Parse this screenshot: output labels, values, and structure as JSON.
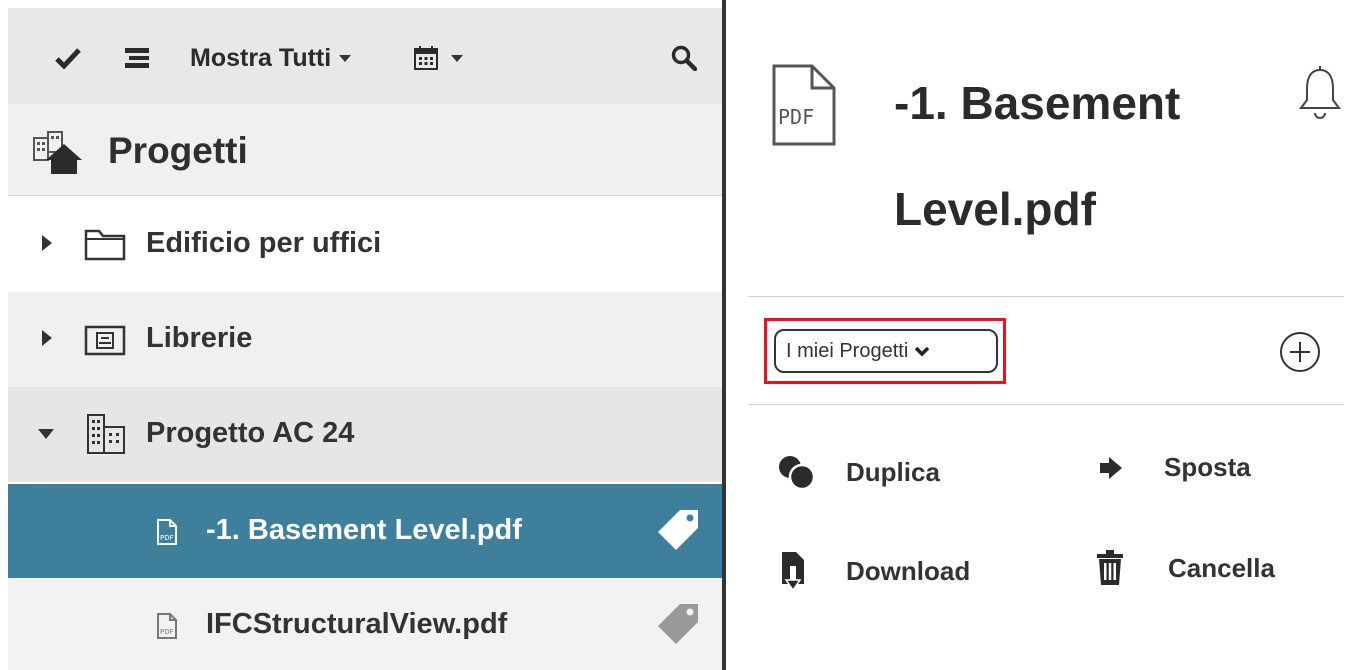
{
  "toolbar": {
    "filter_label": "Mostra Tutti",
    "icons": [
      "check-icon",
      "list-icon",
      "calendar-icon",
      "search-icon"
    ]
  },
  "sidebar": {
    "header": "Progetti",
    "items": [
      {
        "label": "Edificio per uffici",
        "icon": "folder-icon",
        "expanded": false
      },
      {
        "label": "Librerie",
        "icon": "library-folder-icon",
        "expanded": false
      },
      {
        "label": "Progetto AC 24",
        "icon": "building-icon",
        "expanded": true
      },
      {
        "label": "-1. Basement Level.pdf",
        "icon": "pdf-file-icon",
        "selected": true
      },
      {
        "label": "IFCStructuralView.pdf",
        "icon": "pdf-file-icon",
        "selected": false
      }
    ]
  },
  "detail": {
    "title": "-1. Basement Level.pdf",
    "file_icon_text": "PDF",
    "project_select": {
      "value": "I miei Progetti"
    },
    "actions": {
      "duplicate": "Duplica",
      "move": "Sposta",
      "download": "Download",
      "delete": "Cancella"
    }
  },
  "colors": {
    "selected_row": "#3e7f9c",
    "highlight_border": "#e8141b",
    "toolbar_bg": "#e8e8e8"
  }
}
